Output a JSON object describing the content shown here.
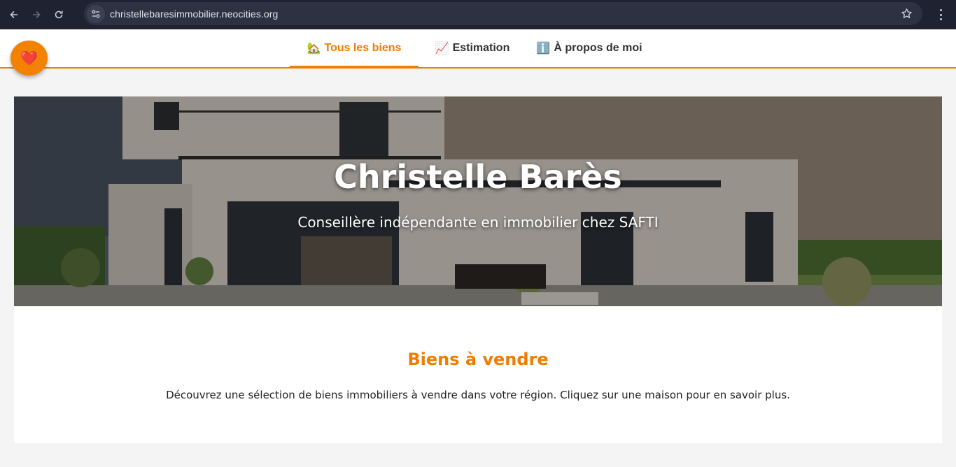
{
  "browser": {
    "url": "christellebaresimmobilier.neocities.org",
    "icons": [
      "back-arrow-icon",
      "forward-arrow-icon",
      "reload-icon",
      "site-settings-icon",
      "bookmark-star-icon",
      "kebab-menu-icon"
    ]
  },
  "favorite": {
    "icon": "❤️"
  },
  "nav": {
    "tabs": [
      {
        "emoji": "🏡",
        "label": "Tous les biens",
        "active": true
      },
      {
        "emoji": "📈",
        "label": "Estimation",
        "active": false
      },
      {
        "emoji": "ℹ️",
        "label": "À propos de moi",
        "active": false
      }
    ]
  },
  "hero": {
    "title": "Christelle Barès",
    "subtitle": "Conseillère indépendante en immobilier chez SAFTI"
  },
  "section": {
    "title": "Biens à vendre",
    "description": "Découvrez une sélection de biens immobiliers à vendre dans votre région. Cliquez sur une maison pour en savoir plus."
  },
  "colors": {
    "accent": "#ef7d00",
    "chrome": "#1f2230",
    "omnibox": "#2d3142"
  }
}
